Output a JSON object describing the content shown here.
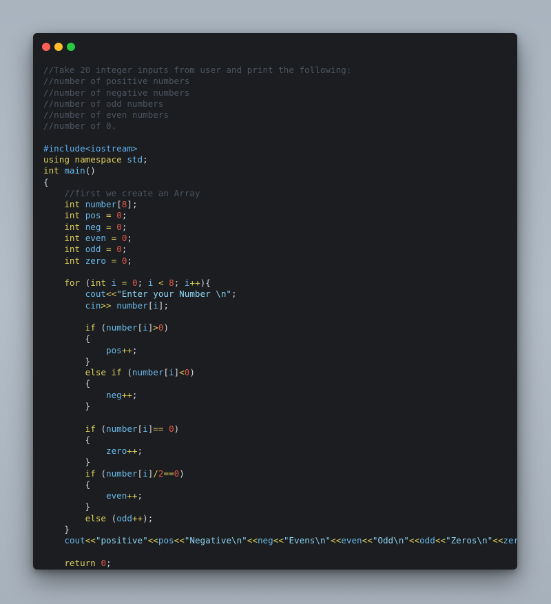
{
  "window": {
    "controls": [
      {
        "name": "close",
        "color": "#ff5f57"
      },
      {
        "name": "minimize",
        "color": "#febc2e"
      },
      {
        "name": "maximize",
        "color": "#28c840"
      }
    ]
  },
  "colors": {
    "comment": "#4d5560",
    "preprocessor": "#61afef",
    "keyword": "#dcd05b",
    "identifier": "#6ab8e8",
    "number": "#e0574a",
    "string": "#8ed4f2",
    "operator": "#dcd05b",
    "punctuation": "#d2d6dc"
  },
  "code": {
    "lines": [
      [
        [
          "comment",
          "//Take 20 integer inputs from user and print the following:"
        ]
      ],
      [
        [
          "comment",
          "//number of positive numbers"
        ]
      ],
      [
        [
          "comment",
          "//number of negative numbers"
        ]
      ],
      [
        [
          "comment",
          "//number of odd numbers"
        ]
      ],
      [
        [
          "comment",
          "//number of even numbers"
        ]
      ],
      [
        [
          "comment",
          "//number of 0."
        ]
      ],
      [],
      [
        [
          "preprocessor",
          "#include<iostream>"
        ]
      ],
      [
        [
          "keyword",
          "using namespace"
        ],
        [
          "punctuation",
          " "
        ],
        [
          "identifier",
          "std"
        ],
        [
          "punctuation",
          ";"
        ]
      ],
      [
        [
          "keyword",
          "int"
        ],
        [
          "punctuation",
          " "
        ],
        [
          "identifier",
          "main"
        ],
        [
          "punctuation",
          "()"
        ]
      ],
      [
        [
          "punctuation",
          "{"
        ]
      ],
      [
        [
          "punctuation",
          "    "
        ],
        [
          "comment",
          "//first we create an Array"
        ]
      ],
      [
        [
          "punctuation",
          "    "
        ],
        [
          "keyword",
          "int"
        ],
        [
          "punctuation",
          " "
        ],
        [
          "identifier",
          "number"
        ],
        [
          "punctuation",
          "["
        ],
        [
          "number",
          "8"
        ],
        [
          "punctuation",
          "];"
        ]
      ],
      [
        [
          "punctuation",
          "    "
        ],
        [
          "keyword",
          "int"
        ],
        [
          "punctuation",
          " "
        ],
        [
          "identifier",
          "pos"
        ],
        [
          "punctuation",
          " "
        ],
        [
          "operator",
          "="
        ],
        [
          "punctuation",
          " "
        ],
        [
          "number",
          "0"
        ],
        [
          "punctuation",
          ";"
        ]
      ],
      [
        [
          "punctuation",
          "    "
        ],
        [
          "keyword",
          "int"
        ],
        [
          "punctuation",
          " "
        ],
        [
          "identifier",
          "neg"
        ],
        [
          "punctuation",
          " "
        ],
        [
          "operator",
          "="
        ],
        [
          "punctuation",
          " "
        ],
        [
          "number",
          "0"
        ],
        [
          "punctuation",
          ";"
        ]
      ],
      [
        [
          "punctuation",
          "    "
        ],
        [
          "keyword",
          "int"
        ],
        [
          "punctuation",
          " "
        ],
        [
          "identifier",
          "even"
        ],
        [
          "punctuation",
          " "
        ],
        [
          "operator",
          "="
        ],
        [
          "punctuation",
          " "
        ],
        [
          "number",
          "0"
        ],
        [
          "punctuation",
          ";"
        ]
      ],
      [
        [
          "punctuation",
          "    "
        ],
        [
          "keyword",
          "int"
        ],
        [
          "punctuation",
          " "
        ],
        [
          "identifier",
          "odd"
        ],
        [
          "punctuation",
          " "
        ],
        [
          "operator",
          "="
        ],
        [
          "punctuation",
          " "
        ],
        [
          "number",
          "0"
        ],
        [
          "punctuation",
          ";"
        ]
      ],
      [
        [
          "punctuation",
          "    "
        ],
        [
          "keyword",
          "int"
        ],
        [
          "punctuation",
          " "
        ],
        [
          "identifier",
          "zero"
        ],
        [
          "punctuation",
          " "
        ],
        [
          "operator",
          "="
        ],
        [
          "punctuation",
          " "
        ],
        [
          "number",
          "0"
        ],
        [
          "punctuation",
          ";"
        ]
      ],
      [],
      [
        [
          "punctuation",
          "    "
        ],
        [
          "keyword",
          "for"
        ],
        [
          "punctuation",
          " ("
        ],
        [
          "keyword",
          "int"
        ],
        [
          "punctuation",
          " "
        ],
        [
          "identifier",
          "i"
        ],
        [
          "punctuation",
          " "
        ],
        [
          "operator",
          "="
        ],
        [
          "punctuation",
          " "
        ],
        [
          "number",
          "0"
        ],
        [
          "punctuation",
          "; "
        ],
        [
          "identifier",
          "i"
        ],
        [
          "punctuation",
          " "
        ],
        [
          "operator",
          "<"
        ],
        [
          "punctuation",
          " "
        ],
        [
          "number",
          "8"
        ],
        [
          "punctuation",
          "; "
        ],
        [
          "identifier",
          "i"
        ],
        [
          "operator",
          "++"
        ],
        [
          "punctuation",
          "){"
        ]
      ],
      [
        [
          "punctuation",
          "        "
        ],
        [
          "identifier",
          "cout"
        ],
        [
          "operator",
          "<<"
        ],
        [
          "string",
          "\"Enter your Number \\n\""
        ],
        [
          "punctuation",
          ";"
        ]
      ],
      [
        [
          "punctuation",
          "        "
        ],
        [
          "identifier",
          "cin"
        ],
        [
          "operator",
          ">>"
        ],
        [
          "punctuation",
          " "
        ],
        [
          "identifier",
          "number"
        ],
        [
          "punctuation",
          "["
        ],
        [
          "identifier",
          "i"
        ],
        [
          "punctuation",
          "];"
        ]
      ],
      [],
      [
        [
          "punctuation",
          "        "
        ],
        [
          "keyword",
          "if"
        ],
        [
          "punctuation",
          " ("
        ],
        [
          "identifier",
          "number"
        ],
        [
          "punctuation",
          "["
        ],
        [
          "identifier",
          "i"
        ],
        [
          "punctuation",
          "]"
        ],
        [
          "operator",
          ">"
        ],
        [
          "number",
          "0"
        ],
        [
          "punctuation",
          ")"
        ]
      ],
      [
        [
          "punctuation",
          "        {"
        ]
      ],
      [
        [
          "punctuation",
          "            "
        ],
        [
          "identifier",
          "pos"
        ],
        [
          "operator",
          "++"
        ],
        [
          "punctuation",
          ";"
        ]
      ],
      [
        [
          "punctuation",
          "        }"
        ]
      ],
      [
        [
          "punctuation",
          "        "
        ],
        [
          "keyword",
          "else if"
        ],
        [
          "punctuation",
          " ("
        ],
        [
          "identifier",
          "number"
        ],
        [
          "punctuation",
          "["
        ],
        [
          "identifier",
          "i"
        ],
        [
          "punctuation",
          "]"
        ],
        [
          "operator",
          "<"
        ],
        [
          "number",
          "0"
        ],
        [
          "punctuation",
          ")"
        ]
      ],
      [
        [
          "punctuation",
          "        {"
        ]
      ],
      [
        [
          "punctuation",
          "            "
        ],
        [
          "identifier",
          "neg"
        ],
        [
          "operator",
          "++"
        ],
        [
          "punctuation",
          ";"
        ]
      ],
      [
        [
          "punctuation",
          "        }"
        ]
      ],
      [],
      [
        [
          "punctuation",
          "        "
        ],
        [
          "keyword",
          "if"
        ],
        [
          "punctuation",
          " ("
        ],
        [
          "identifier",
          "number"
        ],
        [
          "punctuation",
          "["
        ],
        [
          "identifier",
          "i"
        ],
        [
          "punctuation",
          "]"
        ],
        [
          "operator",
          "=="
        ],
        [
          "punctuation",
          " "
        ],
        [
          "number",
          "0"
        ],
        [
          "punctuation",
          ")"
        ]
      ],
      [
        [
          "punctuation",
          "        {"
        ]
      ],
      [
        [
          "punctuation",
          "            "
        ],
        [
          "identifier",
          "zero"
        ],
        [
          "operator",
          "++"
        ],
        [
          "punctuation",
          ";"
        ]
      ],
      [
        [
          "punctuation",
          "        }"
        ]
      ],
      [
        [
          "punctuation",
          "        "
        ],
        [
          "keyword",
          "if"
        ],
        [
          "punctuation",
          " ("
        ],
        [
          "identifier",
          "number"
        ],
        [
          "punctuation",
          "["
        ],
        [
          "identifier",
          "i"
        ],
        [
          "punctuation",
          "]"
        ],
        [
          "operator",
          "/"
        ],
        [
          "number",
          "2"
        ],
        [
          "operator",
          "=="
        ],
        [
          "number",
          "0"
        ],
        [
          "punctuation",
          ")"
        ]
      ],
      [
        [
          "punctuation",
          "        {"
        ]
      ],
      [
        [
          "punctuation",
          "            "
        ],
        [
          "identifier",
          "even"
        ],
        [
          "operator",
          "++"
        ],
        [
          "punctuation",
          ";"
        ]
      ],
      [
        [
          "punctuation",
          "        }"
        ]
      ],
      [
        [
          "punctuation",
          "        "
        ],
        [
          "keyword",
          "else"
        ],
        [
          "punctuation",
          " ("
        ],
        [
          "identifier",
          "odd"
        ],
        [
          "operator",
          "++"
        ],
        [
          "punctuation",
          ");"
        ]
      ],
      [
        [
          "punctuation",
          "    }"
        ]
      ],
      [
        [
          "punctuation",
          "    "
        ],
        [
          "identifier",
          "cout"
        ],
        [
          "operator",
          "<<"
        ],
        [
          "string",
          "\"positive\""
        ],
        [
          "operator",
          "<<"
        ],
        [
          "identifier",
          "pos"
        ],
        [
          "operator",
          "<<"
        ],
        [
          "string",
          "\"Negative\\n\""
        ],
        [
          "operator",
          "<<"
        ],
        [
          "identifier",
          "neg"
        ],
        [
          "operator",
          "<<"
        ],
        [
          "string",
          "\"Evens\\n\""
        ],
        [
          "operator",
          "<<"
        ],
        [
          "identifier",
          "even"
        ],
        [
          "operator",
          "<<"
        ],
        [
          "string",
          "\"Odd\\n\""
        ],
        [
          "operator",
          "<<"
        ],
        [
          "identifier",
          "odd"
        ],
        [
          "operator",
          "<<"
        ],
        [
          "string",
          "\"Zeros\\n\""
        ],
        [
          "operator",
          "<<"
        ],
        [
          "identifier",
          "zero"
        ],
        [
          "punctuation",
          ";"
        ]
      ],
      [],
      [
        [
          "punctuation",
          "    "
        ],
        [
          "keyword",
          "return"
        ],
        [
          "punctuation",
          " "
        ],
        [
          "number",
          "0"
        ],
        [
          "punctuation",
          ";"
        ]
      ]
    ]
  }
}
